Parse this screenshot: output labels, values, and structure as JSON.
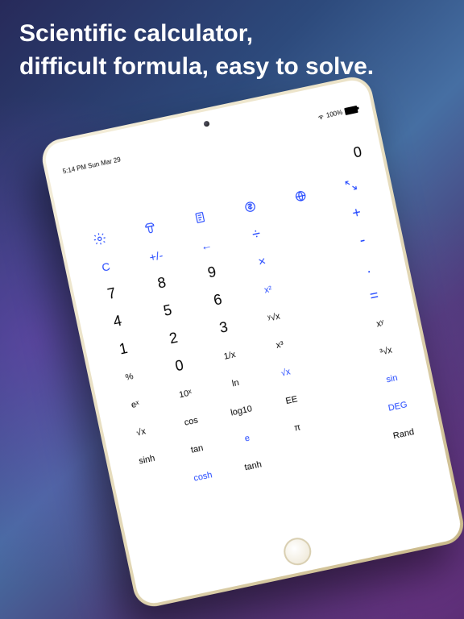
{
  "headline_line1": "Scientific calculator,",
  "headline_line2": "difficult formula, easy to solve.",
  "status": {
    "time_date": "5:14 PM  Sun Mar 29",
    "wifi": "wifi",
    "battery_pct": "100%"
  },
  "display": {
    "value": "0"
  },
  "keys": {
    "clear": "C",
    "posneg": "+/-",
    "backspace": "←",
    "divide": "÷",
    "plus": "+",
    "seven": "7",
    "eight": "8",
    "nine": "9",
    "times": "×",
    "minus": "-",
    "four": "4",
    "five": "5",
    "six": "6",
    "x2": "x²",
    "dot": ".",
    "one": "1",
    "two": "2",
    "three": "3",
    "rootyx": "ʸ√x",
    "equals": "=",
    "percent": "%",
    "zero": "0",
    "recip": "1/x",
    "x3": "x³",
    "xy": "xʸ",
    "ex": "eˣ",
    "tenx": "10ˣ",
    "ln": "ln",
    "rootx": "√x",
    "root3x": "³√x",
    "rootx2": "√x",
    "cos": "cos",
    "log10": "log10",
    "ee": "EE",
    "sin": "sin",
    "sinh": "sinh",
    "tan": "tan",
    "e": "e",
    "pi": "π",
    "deg": "DEG",
    "cosh": "cosh",
    "tanh": "tanh",
    "rand": "Rand"
  }
}
